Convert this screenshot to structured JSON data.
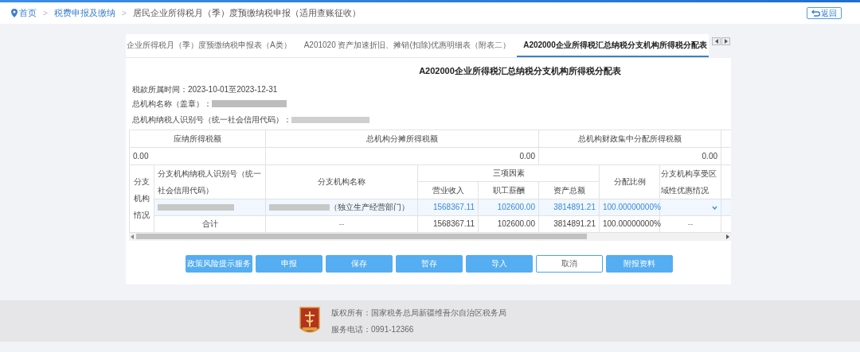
{
  "breadcrumb": [
    {
      "label": "首页",
      "kind": "home"
    },
    {
      "label": "税费申报及缴纳",
      "kind": "link"
    },
    {
      "label": "居民企业所得税月（季）度预缴纳税申报（适用查账征收）",
      "kind": "current"
    }
  ],
  "breadcrumb_separator": ">",
  "back_button": "返回",
  "tabs": [
    {
      "label": "企业所得税月（季）度预缴纳税申报表（A类）",
      "selected": false
    },
    {
      "label": "A201020 资产加速折旧、摊销(扣除)优惠明细表（附表二）",
      "selected": false
    },
    {
      "label": "A202000企业所得税汇总纳税分支机构所得税分配表",
      "selected": true
    }
  ],
  "form": {
    "title": "A202000企业所得税汇总纳税分支机构所得税分配表",
    "period": "税款所属时间：2023-10-01至2023-12-31",
    "org_name_label": "总机构名称（盖章）：",
    "org_id_label": "总机构纳税人识别号（统一社会信用代码）：",
    "summary": {
      "columns": [
        "应纳所得税额",
        "总机构分摊所得税额",
        "总机构财政集中分配所得税额"
      ],
      "values": [
        "0.00",
        "0.00",
        "0.00"
      ]
    },
    "branch_section_label": "分支机构情况",
    "branch_columns": {
      "id": "分支机构纳税人识别号（统一社会信用代码）",
      "name": "分支机构名称",
      "factors": "三项因素",
      "revenue": "营业收入",
      "salary": "职工薪酬",
      "assets": "资产总额",
      "ratio": "分配比例",
      "preference": "分支机构享受区域性优惠情况"
    },
    "rows": [
      {
        "kind": "branch",
        "name_suffix": "（独立生产经营部门）",
        "revenue": "1568367.11",
        "salary": "102600.00",
        "assets": "3814891.21",
        "ratio": "100.00000000%"
      },
      {
        "kind": "total",
        "label": "合计",
        "name": "--",
        "revenue": "1568367.11",
        "salary": "102600.00",
        "assets": "3814891.21",
        "ratio": "100.00000000%",
        "preference": "--"
      }
    ]
  },
  "buttons": [
    {
      "label": "政策风险提示服务",
      "kind": "primary"
    },
    {
      "label": "申报",
      "kind": "primary"
    },
    {
      "label": "保存",
      "kind": "primary"
    },
    {
      "label": "暂存",
      "kind": "primary"
    },
    {
      "label": "导入",
      "kind": "primary"
    },
    {
      "label": "取消",
      "kind": "outline"
    },
    {
      "label": "附报资料",
      "kind": "primary"
    }
  ],
  "footer": {
    "copyright": "版权所有：国家税务总局新疆维吾尔自治区税务局",
    "phone": "服务电话：0991-12366"
  }
}
